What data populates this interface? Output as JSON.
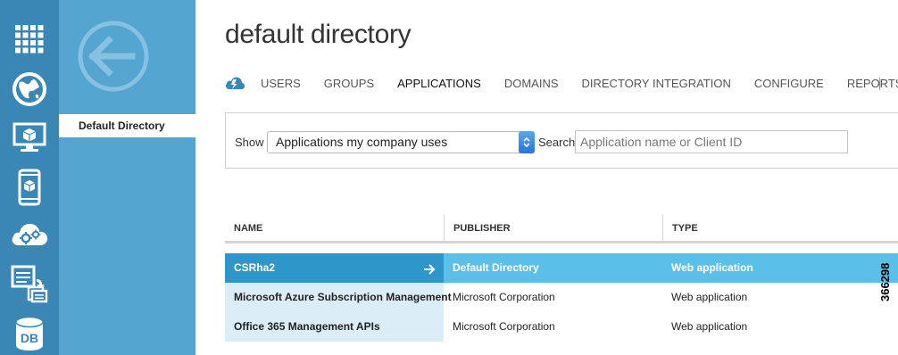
{
  "colors": {
    "rail_bg": "#3a87b5",
    "nav_bg": "#54a5cf",
    "selected_name_bg": "#2e96c8",
    "selected_row_bg": "#5bc0e8",
    "name_cell_bg": "#dbeef8"
  },
  "rail": {
    "items": [
      {
        "icon": "grid-icon"
      },
      {
        "icon": "globe-icon"
      },
      {
        "icon": "monitor-icon"
      },
      {
        "icon": "mobile-icon"
      },
      {
        "icon": "cloud-gear-icon"
      },
      {
        "icon": "documents-icon"
      },
      {
        "icon": "database-icon",
        "label": "DB"
      }
    ]
  },
  "nav": {
    "back_icon": "back-arrow-icon",
    "selected_label": "Default Directory"
  },
  "page": {
    "title": "default directory"
  },
  "tabs": [
    {
      "label": "USERS",
      "active": false
    },
    {
      "label": "GROUPS",
      "active": false
    },
    {
      "label": "APPLICATIONS",
      "active": true
    },
    {
      "label": "DOMAINS",
      "active": false
    },
    {
      "label": "DIRECTORY INTEGRATION",
      "active": false
    },
    {
      "label": "CONFIGURE",
      "active": false
    },
    {
      "label": "REPORTS",
      "active": false
    }
  ],
  "filter": {
    "show_label": "Show",
    "show_value": "Applications my company uses",
    "search_label": "Search",
    "search_placeholder": "Application name or Client ID"
  },
  "table": {
    "headers": [
      "NAME",
      "PUBLISHER",
      "TYPE"
    ],
    "rows": [
      {
        "name": "CSRha2",
        "publisher": "Default Directory",
        "type": "Web application",
        "selected": true
      },
      {
        "name": "Microsoft Azure Subscription Management",
        "publisher": "Microsoft Corporation",
        "type": "Web application",
        "selected": false
      },
      {
        "name": "Office 365 Management APIs",
        "publisher": "Microsoft Corporation",
        "type": "Web application",
        "selected": false
      }
    ]
  },
  "figure_id": "366298"
}
